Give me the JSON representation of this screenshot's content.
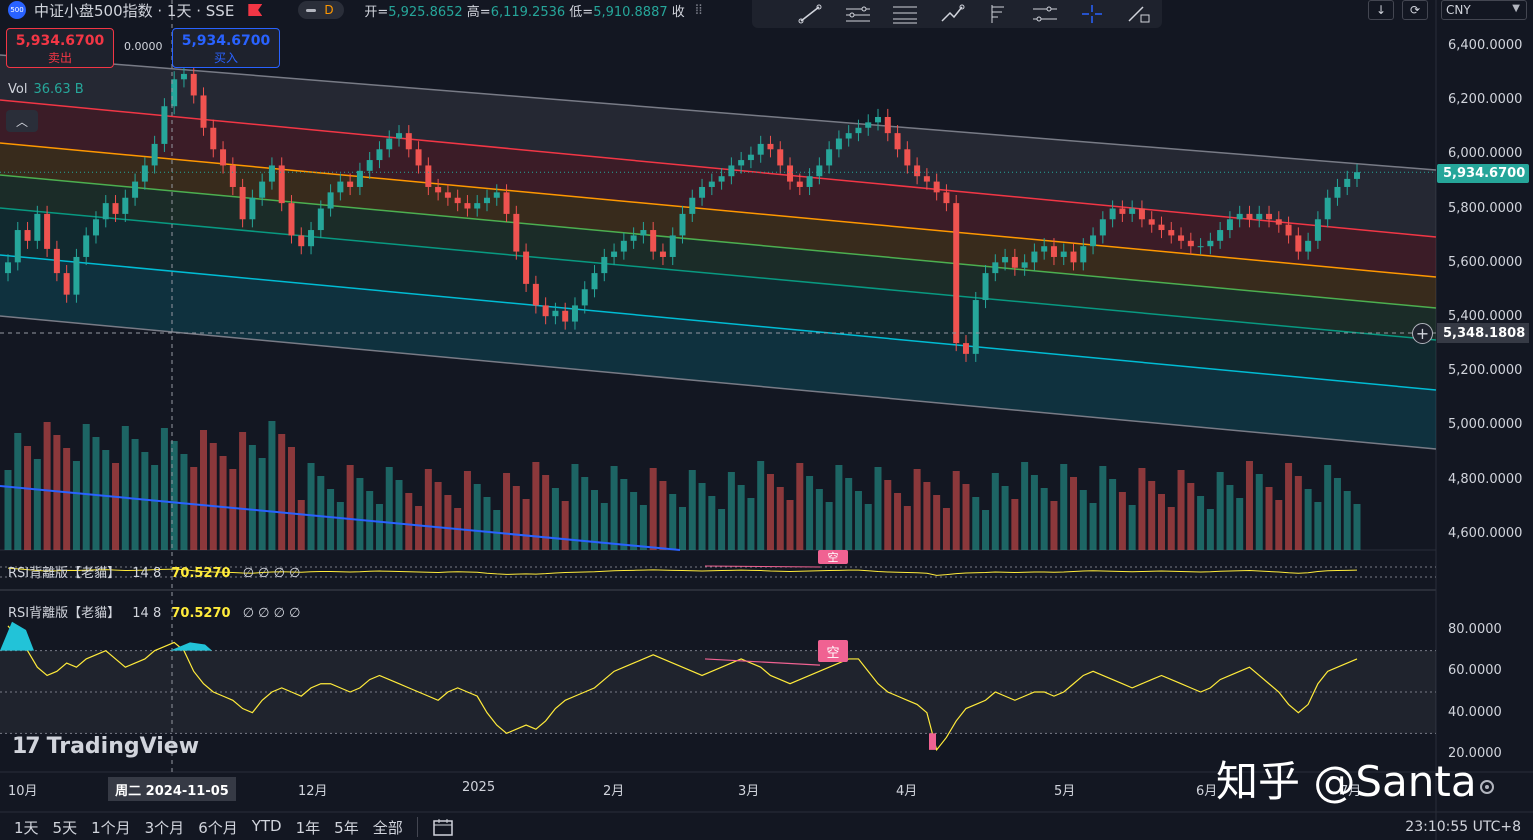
{
  "header": {
    "symbol_logo": "500",
    "title": "中证小盘500指数 · 1天 · SSE",
    "interval_badge": "D",
    "open_label": "开=",
    "open": "5,925.8652",
    "high_label": "高=",
    "high": "6,119.2536",
    "low_label": "低=",
    "low": "5,910.8887",
    "close_label": "收"
  },
  "toolbar": {
    "icons": [
      "trendline-icon",
      "parallel-channel-icon",
      "fib-retracement-icon",
      "path-icon",
      "pitchfork-icon",
      "regression-icon",
      "crosshair-icon",
      "measure-icon"
    ]
  },
  "topright": {
    "currency": "CNY"
  },
  "trade": {
    "sell_price": "5,934.6700",
    "sell_label": "卖出",
    "buy_price": "5,934.6700",
    "buy_label": "买入",
    "spread": "0.0000"
  },
  "volume": {
    "label": "Vol",
    "value": "36.63 B"
  },
  "rsi1": {
    "name": "RSI背離版【老貓】",
    "params": "14 8",
    "value": "70.5270",
    "extras": "∅ ∅ ∅ ∅"
  },
  "rsi2": {
    "name": "RSI背離版【老貓】",
    "params": "14 8",
    "value": "70.5270",
    "extras": "∅ ∅ ∅ ∅",
    "signal": "空"
  },
  "price_axis": [
    "6,400.0000",
    "6,200.0000",
    "6,000.0000",
    "5,800.0000",
    "5,600.0000",
    "5,400.0000",
    "5,200.0000",
    "5,000.0000",
    "4,800.0000",
    "4,600.0000"
  ],
  "last_price": "5,934.6700",
  "crosshair_price": "5,348.1808",
  "rsi_axis": [
    "80.0000",
    "60.0000",
    "40.0000",
    "20.0000"
  ],
  "time_axis": [
    "10月",
    "12月",
    "2025",
    "2月",
    "3月",
    "4月",
    "5月",
    "6月",
    "7月"
  ],
  "crosshair_date": "周二 2024-11-05",
  "ranges": [
    "1天",
    "5天",
    "1个月",
    "3个月",
    "6个月",
    "YTD",
    "1年",
    "5年",
    "全部"
  ],
  "clock": "23:10:55 UTC+8",
  "brand": "TradingView",
  "watermark": "知乎 @Santa",
  "colors": {
    "up": "#26a69a",
    "down": "#ef5350",
    "accent": "#2962ff"
  },
  "chart_data": {
    "type": "candlestick",
    "close_series": [
      5600,
      5720,
      5680,
      5780,
      5650,
      5560,
      5480,
      5620,
      5700,
      5760,
      5820,
      5780,
      5840,
      5900,
      5960,
      6040,
      6180,
      6280,
      6300,
      6220,
      6100,
      6020,
      5960,
      5880,
      5760,
      5840,
      5900,
      5960,
      5820,
      5700,
      5660,
      5720,
      5800,
      5860,
      5900,
      5880,
      5940,
      5980,
      6020,
      6060,
      6080,
      6020,
      5960,
      5880,
      5860,
      5840,
      5820,
      5800,
      5820,
      5840,
      5860,
      5780,
      5640,
      5520,
      5440,
      5400,
      5420,
      5380,
      5440,
      5500,
      5560,
      5620,
      5640,
      5680,
      5700,
      5720,
      5640,
      5620,
      5700,
      5780,
      5840,
      5880,
      5900,
      5920,
      5960,
      5980,
      6000,
      6040,
      6020,
      5960,
      5900,
      5880,
      5920,
      5960,
      6020,
      6060,
      6080,
      6100,
      6120,
      6140,
      6080,
      6020,
      5960,
      5920,
      5900,
      5860,
      5820,
      5300,
      5260,
      5460,
      5560,
      5600,
      5620,
      5580,
      5600,
      5640,
      5660,
      5620,
      5640,
      5600,
      5660,
      5700,
      5760,
      5800,
      5780,
      5800,
      5760,
      5740,
      5720,
      5700,
      5680,
      5660,
      5660,
      5680,
      5720,
      5760,
      5780,
      5760,
      5780,
      5760,
      5740,
      5700,
      5640,
      5680,
      5760,
      5840,
      5880,
      5910,
      5935
    ],
    "rsi_series": [
      82,
      76,
      70,
      62,
      58,
      60,
      64,
      62,
      66,
      68,
      70,
      66,
      62,
      64,
      66,
      70,
      72,
      74,
      70,
      60,
      54,
      50,
      48,
      46,
      42,
      40,
      46,
      50,
      52,
      50,
      48,
      52,
      54,
      54,
      52,
      50,
      52,
      56,
      58,
      56,
      54,
      52,
      50,
      48,
      46,
      50,
      52,
      50,
      48,
      40,
      34,
      30,
      32,
      34,
      32,
      36,
      42,
      46,
      48,
      50,
      52,
      56,
      60,
      62,
      64,
      66,
      68,
      66,
      64,
      62,
      60,
      58,
      60,
      62,
      64,
      66,
      64,
      62,
      58,
      56,
      54,
      56,
      58,
      60,
      62,
      64,
      66,
      66,
      60,
      54,
      50,
      48,
      46,
      44,
      40,
      22,
      28,
      36,
      42,
      44,
      46,
      50,
      48,
      46,
      48,
      50,
      50,
      48,
      50,
      54,
      58,
      60,
      58,
      56,
      54,
      52,
      54,
      56,
      58,
      56,
      54,
      52,
      50,
      52,
      56,
      58,
      60,
      62,
      58,
      54,
      50,
      44,
      40,
      44,
      54,
      60,
      62,
      64,
      66
    ]
  }
}
